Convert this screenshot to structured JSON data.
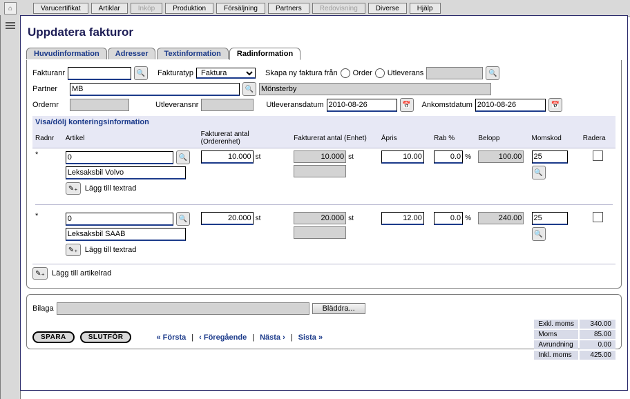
{
  "menubar": {
    "items": [
      "Varucertifikat",
      "Artiklar",
      "Inköp",
      "Produktion",
      "Försäljning",
      "Partners",
      "Redovisning",
      "Diverse",
      "Hjälp"
    ],
    "disabled": [
      2,
      6
    ]
  },
  "page_title": "Uppdatera fakturor",
  "tabs": [
    "Huvudinformation",
    "Adresser",
    "Textinformation",
    "Radinformation"
  ],
  "active_tab": 3,
  "header": {
    "fakturanr_label": "Fakturanr",
    "fakturanr": "",
    "fakturatyp_label": "Fakturatyp",
    "fakturatyp_value": "Faktura",
    "skapa_label": "Skapa ny faktura från",
    "order_label": "Order",
    "utleverans_label": "Utleverans",
    "utleverans_value": "",
    "partner_label": "Partner",
    "partner_code": "MB",
    "partner_name": "Mönsterby",
    "ordernr_label": "Ordernr",
    "ordernr": "",
    "utleveransnr_label": "Utleveransnr",
    "utleveransnr": "",
    "utleveransdatum_label": "Utleveransdatum",
    "utleveransdatum": "2010-08-26",
    "ankomstdatum_label": "Ankomstdatum",
    "ankomstdatum": "2010-08-26"
  },
  "grid": {
    "toggle_label": "Visa/dölj konteringsinformation",
    "columns": {
      "radnr": "Radnr",
      "artikel": "Artikel",
      "fakt_order": "Fakturerat antal (Orderenhet)",
      "fakt_enhet": "Fakturerat antal (Enhet)",
      "apris": "Ápris",
      "rab": "Rab %",
      "belopp": "Belopp",
      "momskod": "Momskod",
      "radera": "Radera"
    },
    "rows": [
      {
        "radnr": "*",
        "artikel_code": "0",
        "artikel_name": "Leksaksbil Volvo",
        "fakt_order": "10.000",
        "order_unit": "st",
        "fakt_enhet": "10.000",
        "enhet_unit": "st",
        "apris": "10.00",
        "rab": "0.0",
        "belopp": "100.00",
        "momskod": "25"
      },
      {
        "radnr": "*",
        "artikel_code": "0",
        "artikel_name": "Leksaksbil SAAB",
        "fakt_order": "20.000",
        "order_unit": "st",
        "fakt_enhet": "20.000",
        "enhet_unit": "st",
        "apris": "12.00",
        "rab": "0.0",
        "belopp": "240.00",
        "momskod": "25"
      }
    ],
    "add_text_label": "Lägg till textrad",
    "add_article_label": "Lägg till artikelrad"
  },
  "bottom": {
    "bilaga_label": "Bilaga",
    "bilaga_value": "",
    "browse_label": "Bläddra...",
    "save_label": "SPARA",
    "finish_label": "SLUTFÖR",
    "pager_first": "« Första",
    "pager_prev": "‹ Föregående",
    "pager_next": "Nästa ›",
    "pager_last": "Sista »",
    "totals": {
      "excl_label": "Exkl. moms",
      "excl": "340.00",
      "moms_label": "Moms",
      "moms": "85.00",
      "avr_label": "Avrundning",
      "avr": "0.00",
      "incl_label": "Inkl. moms",
      "incl": "425.00"
    }
  }
}
